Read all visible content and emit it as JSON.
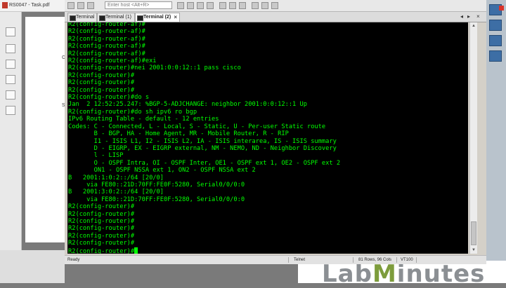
{
  "background_pdf": {
    "title": "RS0047 - Task.pdf"
  },
  "toolbar": {
    "host_placeholder": "Enter host <Alt+R>"
  },
  "tabs": [
    {
      "label": "Terminal",
      "active": false
    },
    {
      "label": "Terminal (1)",
      "active": false
    },
    {
      "label": "Terminal (2)",
      "active": true
    }
  ],
  "terminal": {
    "prompt": "R2(config-router)#",
    "lines": [
      "R2(config-router-af)#",
      "R2(config-router-af)#",
      "R2(config-router-af)#",
      "R2(config-router-af)#",
      "R2(config-router-af)#",
      "R2(config-router-af)#exi",
      "R2(config-router)#nei 2001:0:0:12::1 pass cisco",
      "R2(config-router)#",
      "R2(config-router)#",
      "R2(config-router)#",
      "R2(config-router)#do s",
      "Jan  2 12:52:25.247: %BGP-5-ADJCHANGE: neighbor 2001:0:0:12::1 Up",
      "R2(config-router)#do sh ipv6 ro bgp",
      "IPv6 Routing Table - default - 12 entries",
      "Codes: C - Connected, L - Local, S - Static, U - Per-user Static route",
      "       B - BGP, HA - Home Agent, MR - Mobile Router, R - RIP",
      "       I1 - ISIS L1, I2 - ISIS L2, IA - ISIS interarea, IS - ISIS summary",
      "       D - EIGRP, EX - EIGRP external, NM - NEMO, ND - Neighbor Discovery",
      "       l - LISP",
      "       O - OSPF Intra, OI - OSPF Inter, OE1 - OSPF ext 1, OE2 - OSPF ext 2",
      "       ON1 - OSPF NSSA ext 1, ON2 - OSPF NSSA ext 2",
      "B   2001:1:0:2::/64 [20/0]",
      "     via FE80::21D:70FF:FE0F:5280, Serial0/0/0:0",
      "B   2001:3:0:2::/64 [20/0]",
      "     via FE80::21D:70FF:FE0F:5280, Serial0/0/0:0",
      "R2(config-router)#",
      "R2(config-router)#",
      "R2(config-router)#",
      "R2(config-router)#",
      "R2(config-router)#",
      "R2(config-router)#",
      "R2(config-router)#"
    ]
  },
  "status": {
    "ready": "Ready",
    "protocol": "Telnet",
    "size": "81 Rows, 96 Cols",
    "emulation": "VT100"
  },
  "logo": {
    "part1": "Lab",
    "part2": "M",
    "part3": "inutes"
  },
  "colors": {
    "terminal_bg": "#000000",
    "terminal_fg": "#00ff00",
    "logo_green": "#7d9c3c",
    "logo_gray": "#8b8f93"
  }
}
